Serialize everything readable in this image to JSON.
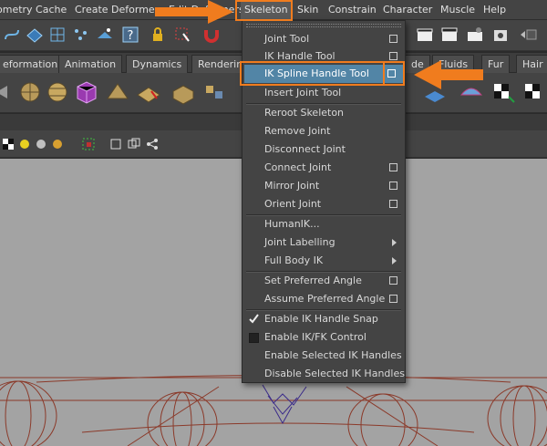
{
  "menubar": {
    "items": [
      "ometry Cache",
      "Create Deformers",
      "Edit Deformers",
      "Skeleton",
      "Skin",
      "Constrain",
      "Character",
      "Muscle",
      "Help"
    ],
    "active": "Skeleton"
  },
  "shelf_tabs": [
    "eformation",
    "Animation",
    "Dynamics",
    "Rendering",
    "de",
    "Fluids",
    "Fur",
    "Hair"
  ],
  "skeleton_menu": {
    "items": [
      {
        "label": "Joint Tool",
        "option_box": true
      },
      {
        "label": "IK Handle Tool",
        "option_box": true
      },
      {
        "label": "IK Spline Handle Tool",
        "option_box": true,
        "highlighted": true
      },
      {
        "label": "Insert Joint Tool"
      },
      {
        "label": "Reroot Skeleton"
      },
      {
        "label": "Remove Joint"
      },
      {
        "label": "Disconnect Joint"
      },
      {
        "label": "Connect Joint",
        "option_box": true
      },
      {
        "label": "Mirror Joint",
        "option_box": true
      },
      {
        "label": "Orient Joint",
        "option_box": true
      },
      {
        "label": "HumanIK..."
      },
      {
        "label": "Joint Labelling",
        "submenu": true
      },
      {
        "label": "Full Body IK",
        "submenu": true
      },
      {
        "label": "Set Preferred Angle",
        "option_box": true
      },
      {
        "label": "Assume Preferred Angle",
        "option_box": true
      },
      {
        "label": "Enable IK Handle Snap",
        "checked": true
      },
      {
        "label": "Enable IK/FK Control",
        "checked": false
      },
      {
        "label": "Enable Selected IK Handles"
      },
      {
        "label": "Disable Selected IK Handles"
      }
    ]
  },
  "colors": {
    "highlight": "#5285a6",
    "annotation": "#f07c1e",
    "viewport": "#a3a3a3",
    "rig_lines": "#8b3a2a",
    "joint_lines": "#3a2a8a"
  },
  "icons": {
    "menu_annotation_arrow": "right-arrow",
    "item_annotation_arrow": "left-arrow"
  }
}
